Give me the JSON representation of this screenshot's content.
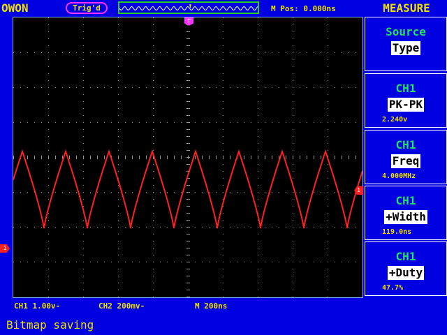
{
  "header": {
    "brand": "OWON",
    "trigger_status": "Trig'd",
    "m_pos": "M Pos: 0.000ns",
    "menu_title": "MEASURE"
  },
  "markers": {
    "ch1": "1",
    "trigger_level": "1",
    "trigger_position": "T"
  },
  "menu": [
    {
      "title": "Source",
      "value": "Type",
      "reading": ""
    },
    {
      "title": "CH1",
      "value": "PK-PK",
      "reading": "2.240v"
    },
    {
      "title": "CH1",
      "value": "Freq",
      "reading": "4.000MHz"
    },
    {
      "title": "CH1",
      "value": "+Width",
      "reading": "119.0ns"
    },
    {
      "title": "CH1",
      "value": "+Duty",
      "reading": "47.7%"
    }
  ],
  "footer": {
    "ch1_scale": "CH1 1.00v-",
    "ch2_scale": "CH2 200mv-",
    "time_base": "M  200ns"
  },
  "status": "Bitmap saving",
  "colors": {
    "background": "#0000e0",
    "trace_ch1": "#ff2020",
    "text": "#f0e000",
    "menu_title": "#20e060"
  }
}
